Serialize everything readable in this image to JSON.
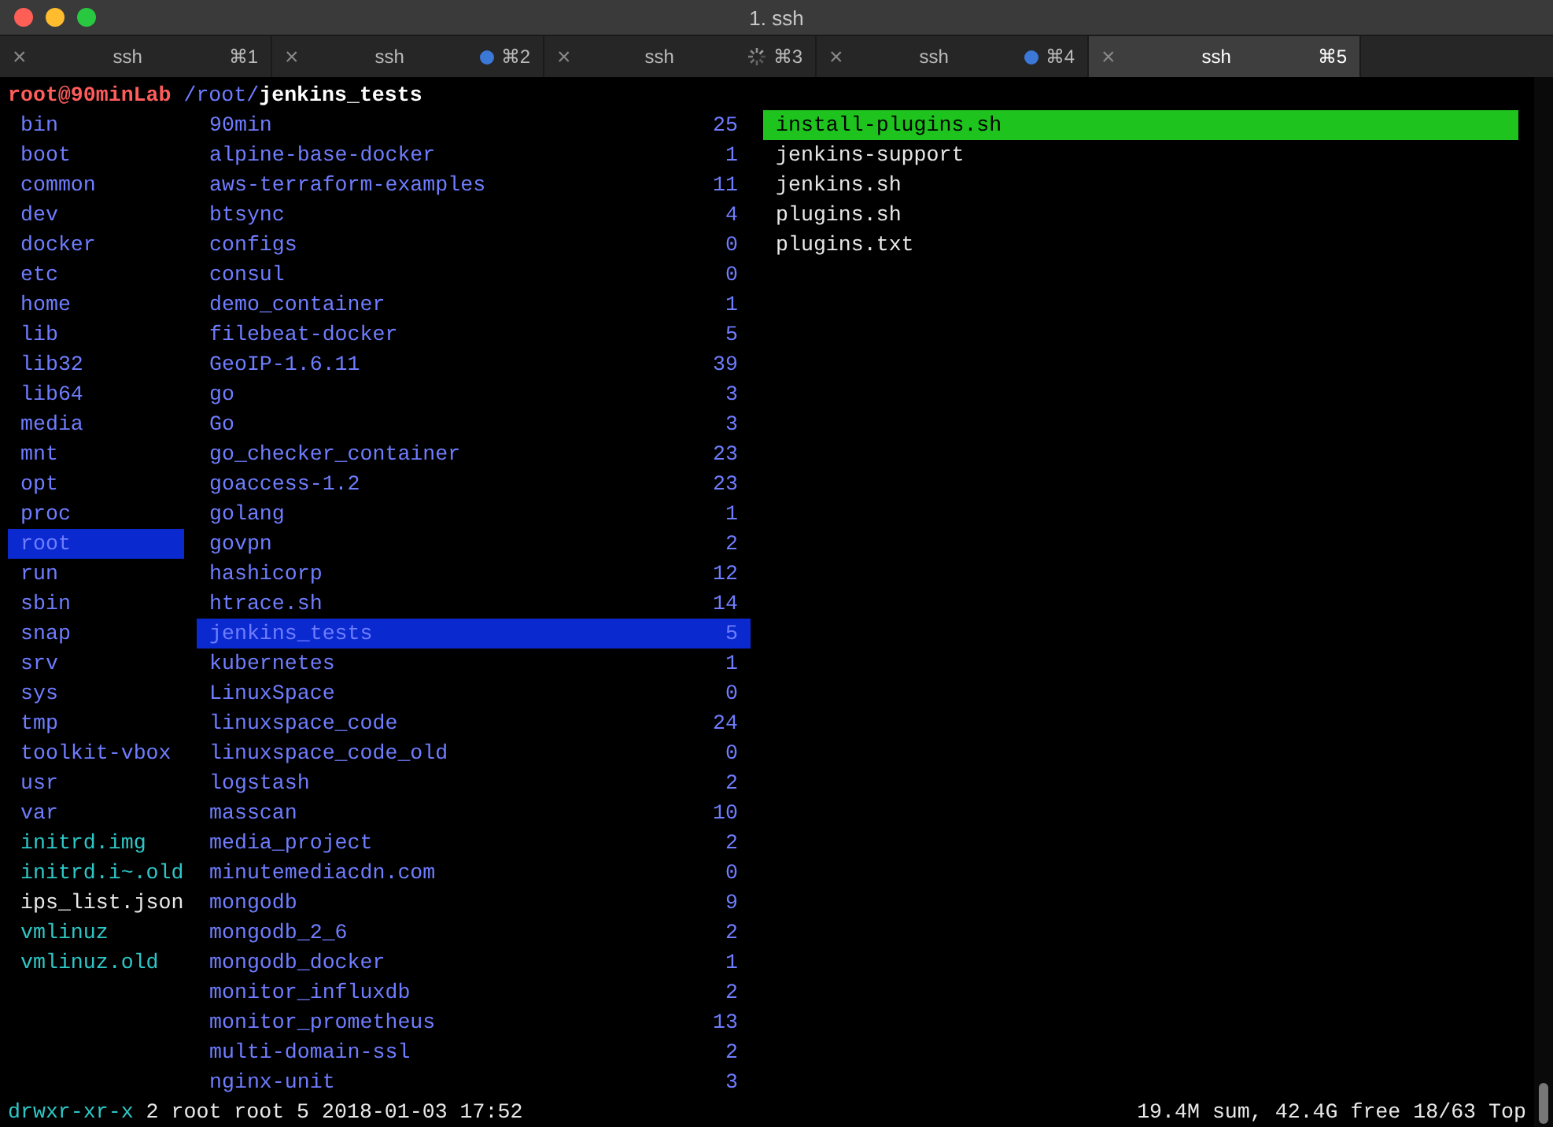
{
  "window": {
    "title": "1. ssh"
  },
  "tabs": [
    {
      "close": "×",
      "label": "ssh",
      "kind": "plain",
      "shortcut": "⌘1",
      "selected": false
    },
    {
      "close": "×",
      "label": "ssh",
      "kind": "activity",
      "shortcut": "⌘2",
      "selected": false
    },
    {
      "close": "×",
      "label": "ssh",
      "kind": "busy",
      "shortcut": "⌘3",
      "selected": false
    },
    {
      "close": "×",
      "label": "ssh",
      "kind": "activity",
      "shortcut": "⌘4",
      "selected": false
    },
    {
      "close": "×",
      "label": "ssh",
      "kind": "plain",
      "shortcut": "⌘5",
      "selected": true
    }
  ],
  "path": {
    "host": "root@90minLab",
    "parent": "/root/",
    "current": "jenkins_tests"
  },
  "parent_column": [
    {
      "name": "bin",
      "kind": "dir",
      "selected": false
    },
    {
      "name": "boot",
      "kind": "dir",
      "selected": false
    },
    {
      "name": "common",
      "kind": "dir",
      "selected": false
    },
    {
      "name": "dev",
      "kind": "dir",
      "selected": false
    },
    {
      "name": "docker",
      "kind": "dir",
      "selected": false
    },
    {
      "name": "etc",
      "kind": "dir",
      "selected": false
    },
    {
      "name": "home",
      "kind": "dir",
      "selected": false
    },
    {
      "name": "lib",
      "kind": "dir",
      "selected": false
    },
    {
      "name": "lib32",
      "kind": "dir",
      "selected": false
    },
    {
      "name": "lib64",
      "kind": "dir",
      "selected": false
    },
    {
      "name": "media",
      "kind": "dir",
      "selected": false
    },
    {
      "name": "mnt",
      "kind": "dir",
      "selected": false
    },
    {
      "name": "opt",
      "kind": "dir",
      "selected": false
    },
    {
      "name": "proc",
      "kind": "dir",
      "selected": false
    },
    {
      "name": "root",
      "kind": "dir",
      "selected": true
    },
    {
      "name": "run",
      "kind": "dir",
      "selected": false
    },
    {
      "name": "sbin",
      "kind": "dir",
      "selected": false
    },
    {
      "name": "snap",
      "kind": "dir",
      "selected": false
    },
    {
      "name": "srv",
      "kind": "dir",
      "selected": false
    },
    {
      "name": "sys",
      "kind": "dir",
      "selected": false
    },
    {
      "name": "tmp",
      "kind": "dir",
      "selected": false
    },
    {
      "name": "toolkit-vbox",
      "kind": "dir",
      "selected": false
    },
    {
      "name": "usr",
      "kind": "dir",
      "selected": false
    },
    {
      "name": "var",
      "kind": "dir",
      "selected": false
    },
    {
      "name": "initrd.img",
      "kind": "link",
      "selected": false
    },
    {
      "name": "initrd.i~.old",
      "kind": "link",
      "selected": false
    },
    {
      "name": "ips_list.json",
      "kind": "file",
      "selected": false
    },
    {
      "name": "vmlinuz",
      "kind": "link",
      "selected": false
    },
    {
      "name": "vmlinuz.old",
      "kind": "link",
      "selected": false
    }
  ],
  "current_column": [
    {
      "name": "90min",
      "count": "25",
      "selected": false
    },
    {
      "name": "alpine-base-docker",
      "count": "1",
      "selected": false
    },
    {
      "name": "aws-terraform-examples",
      "count": "11",
      "selected": false
    },
    {
      "name": "btsync",
      "count": "4",
      "selected": false
    },
    {
      "name": "configs",
      "count": "0",
      "selected": false
    },
    {
      "name": "consul",
      "count": "0",
      "selected": false
    },
    {
      "name": "demo_container",
      "count": "1",
      "selected": false
    },
    {
      "name": "filebeat-docker",
      "count": "5",
      "selected": false
    },
    {
      "name": "GeoIP-1.6.11",
      "count": "39",
      "selected": false
    },
    {
      "name": "go",
      "count": "3",
      "selected": false
    },
    {
      "name": "Go",
      "count": "3",
      "selected": false
    },
    {
      "name": "go_checker_container",
      "count": "23",
      "selected": false
    },
    {
      "name": "goaccess-1.2",
      "count": "23",
      "selected": false
    },
    {
      "name": "golang",
      "count": "1",
      "selected": false
    },
    {
      "name": "govpn",
      "count": "2",
      "selected": false
    },
    {
      "name": "hashicorp",
      "count": "12",
      "selected": false
    },
    {
      "name": "htrace.sh",
      "count": "14",
      "selected": false
    },
    {
      "name": "jenkins_tests",
      "count": "5",
      "selected": true
    },
    {
      "name": "kubernetes",
      "count": "1",
      "selected": false
    },
    {
      "name": "LinuxSpace",
      "count": "0",
      "selected": false
    },
    {
      "name": "linuxspace_code",
      "count": "24",
      "selected": false
    },
    {
      "name": "linuxspace_code_old",
      "count": "0",
      "selected": false
    },
    {
      "name": "logstash",
      "count": "2",
      "selected": false
    },
    {
      "name": "masscan",
      "count": "10",
      "selected": false
    },
    {
      "name": "media_project",
      "count": "2",
      "selected": false
    },
    {
      "name": "minutemediacdn.com",
      "count": "0",
      "selected": false
    },
    {
      "name": "mongodb",
      "count": "9",
      "selected": false
    },
    {
      "name": "mongodb_2_6",
      "count": "2",
      "selected": false
    },
    {
      "name": "mongodb_docker",
      "count": "1",
      "selected": false
    },
    {
      "name": "monitor_influxdb",
      "count": "2",
      "selected": false
    },
    {
      "name": "monitor_prometheus",
      "count": "13",
      "selected": false
    },
    {
      "name": "multi-domain-ssl",
      "count": "2",
      "selected": false
    },
    {
      "name": "nginx-unit",
      "count": "3",
      "selected": false
    }
  ],
  "preview_column": [
    {
      "name": "install-plugins.sh",
      "selected": true
    },
    {
      "name": "jenkins-support",
      "selected": false
    },
    {
      "name": "jenkins.sh",
      "selected": false
    },
    {
      "name": "plugins.sh",
      "selected": false
    },
    {
      "name": "plugins.txt",
      "selected": false
    }
  ],
  "status_bar": {
    "permissions": "drwxr-xr-x",
    "details": "2 root root 5 2018-01-03 17:52",
    "disk": "19.4M sum, 42.4G free",
    "position": "18/63",
    "scroll": "Top"
  }
}
